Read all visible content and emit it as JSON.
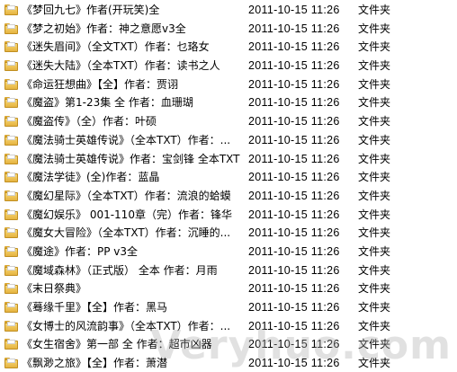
{
  "files": [
    {
      "name": "《梦回九七》作者(开玩笑)全",
      "modified": "2011-10-15 11:26",
      "type": "文件夹",
      "icon": "folder-icon"
    },
    {
      "name": "《梦之初始》作者：神之意愿v3全",
      "modified": "2011-10-15 11:26",
      "type": "文件夹",
      "icon": "folder-icon"
    },
    {
      "name": "《迷失眉间》（全文TXT）作者：乜珞女",
      "modified": "2011-10-15 11:26",
      "type": "文件夹",
      "icon": "folder-icon"
    },
    {
      "name": "《迷失大陆》（全本TXT）作者：读书之人",
      "modified": "2011-10-15 11:26",
      "type": "文件夹",
      "icon": "folder-icon"
    },
    {
      "name": "《命运狂想曲》【全】作者：贾诩",
      "modified": "2011-10-15 11:26",
      "type": "文件夹",
      "icon": "folder-icon"
    },
    {
      "name": "《魔盗》第1-23集 全 作者：血珊瑚",
      "modified": "2011-10-15 11:26",
      "type": "文件夹",
      "icon": "folder-icon"
    },
    {
      "name": "《魔盗传》（全）作者：叶硕",
      "modified": "2011-10-15 11:26",
      "type": "文件夹",
      "icon": "folder-icon"
    },
    {
      "name": "《魔法骑士英雄传说》（全本TXT）作者：...",
      "modified": "2011-10-15 11:26",
      "type": "文件夹",
      "icon": "folder-icon"
    },
    {
      "name": "《魔法骑士英雄传说》作者：宝剑锋 全本TXT",
      "modified": "2011-10-15 11:26",
      "type": "文件夹",
      "icon": "folder-icon"
    },
    {
      "name": "《魔法学徒》(全)作者：蓝晶",
      "modified": "2011-10-15 11:26",
      "type": "文件夹",
      "icon": "folder-icon"
    },
    {
      "name": "《魔幻星际》（全本TXT）作者：流浪的蛤蟆",
      "modified": "2011-10-15 11:26",
      "type": "文件夹",
      "icon": "folder-icon"
    },
    {
      "name": "《魔幻娱乐》 001-110章（完）作者：锋华",
      "modified": "2011-10-15 11:26",
      "type": "文件夹",
      "icon": "folder-icon"
    },
    {
      "name": "《魔女大冒险》（全本TXT）作者：沉睡的...",
      "modified": "2011-10-15 11:26",
      "type": "文件夹",
      "icon": "folder-icon"
    },
    {
      "name": "《魔途》作者：PP v3全",
      "modified": "2011-10-15 11:26",
      "type": "文件夹",
      "icon": "folder-icon"
    },
    {
      "name": "《魔域森林》（正式版） 全本 作者：月雨",
      "modified": "2011-10-15 11:26",
      "type": "文件夹",
      "icon": "folder-icon"
    },
    {
      "name": "《末日祭典》",
      "modified": "2011-10-15 11:26",
      "type": "文件夹",
      "icon": "folder-icon"
    },
    {
      "name": "《蓦缘千里》【全】作者：黑马",
      "modified": "2011-10-15 11:26",
      "type": "文件夹",
      "icon": "folder-icon"
    },
    {
      "name": "《女博士的风流韵事》（全本TXT）作者：...",
      "modified": "2011-10-15 11:26",
      "type": "文件夹",
      "icon": "folder-icon"
    },
    {
      "name": "《女生宿舍》第一部 全 作者：超市凶器",
      "modified": "2011-10-15 11:26",
      "type": "文件夹",
      "icon": "folder-icon"
    },
    {
      "name": "《飘渺之旅》【全】作者：萧潜",
      "modified": "2011-10-15 11:26",
      "type": "文件夹",
      "icon": "folder-icon"
    }
  ],
  "watermark": "Veryhuo.com",
  "colors": {
    "folder_fill": "#f7d774",
    "folder_border": "#c08e20",
    "text": "#000000",
    "background": "#ffffff"
  }
}
